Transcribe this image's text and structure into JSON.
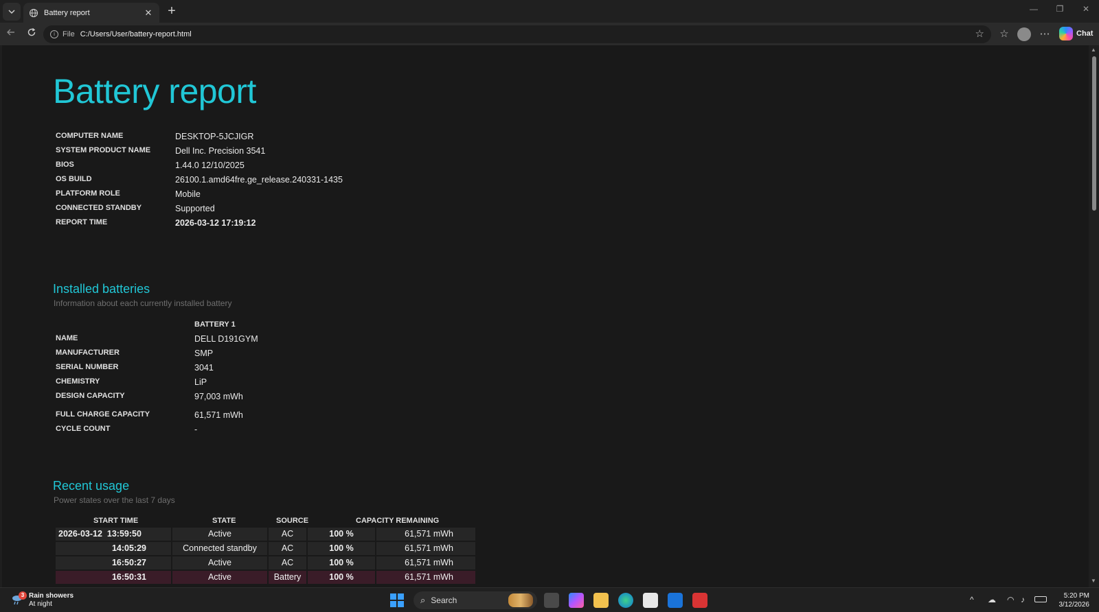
{
  "browser": {
    "tab_title": "Battery report",
    "close_glyph": "✕",
    "new_tab_glyph": "+",
    "url_scheme_label": "File",
    "url": "C:/Users/User/battery-report.html",
    "chat_label": "Chat",
    "icons": [
      "tab-list-icon",
      "globe-icon",
      "back-icon",
      "refresh-icon",
      "info-icon",
      "star-icon",
      "favorites-icon",
      "profile-icon",
      "more-icon",
      "copilot-icon",
      "minimize-icon",
      "restore-icon",
      "close-window-icon"
    ]
  },
  "report": {
    "title": "Battery report",
    "system_info": [
      {
        "key": "COMPUTER NAME",
        "value": "DESKTOP-5JCJIGR"
      },
      {
        "key": "SYSTEM PRODUCT NAME",
        "value": "Dell Inc. Precision 3541"
      },
      {
        "key": "BIOS",
        "value": "1.44.0 12/10/2025"
      },
      {
        "key": "OS BUILD",
        "value": "26100.1.amd64fre.ge_release.240331-1435"
      },
      {
        "key": "PLATFORM ROLE",
        "value": "Mobile"
      },
      {
        "key": "CONNECTED STANDBY",
        "value": "Supported"
      },
      {
        "key": "REPORT TIME",
        "value": "2026-03-12  17:19:12"
      }
    ],
    "installed_batteries": {
      "heading": "Installed batteries",
      "subheading": "Information about each currently installed battery",
      "column": "BATTERY 1",
      "rows": [
        {
          "key": "NAME",
          "value": "DELL D191GYM"
        },
        {
          "key": "MANUFACTURER",
          "value": "SMP"
        },
        {
          "key": "SERIAL NUMBER",
          "value": "3041"
        },
        {
          "key": "CHEMISTRY",
          "value": "LiP"
        },
        {
          "key": "DESIGN CAPACITY",
          "value": "97,003 mWh"
        },
        {
          "key": "FULL CHARGE CAPACITY",
          "value": "61,571 mWh"
        },
        {
          "key": "CYCLE COUNT",
          "value": "-"
        }
      ]
    },
    "recent_usage": {
      "heading": "Recent usage",
      "subheading": "Power states over the last 7 days",
      "headers": {
        "start_time": "START TIME",
        "state": "STATE",
        "source": "SOURCE",
        "capacity": "CAPACITY REMAINING"
      },
      "rows": [
        {
          "date": "2026-03-12",
          "time": "13:59:50",
          "state": "Active",
          "source": "AC",
          "percent": "100 %",
          "mwh": "61,571 mWh"
        },
        {
          "date": "",
          "time": "14:05:29",
          "state": "Connected standby",
          "source": "AC",
          "percent": "100 %",
          "mwh": "61,571 mWh"
        },
        {
          "date": "",
          "time": "16:50:27",
          "state": "Active",
          "source": "AC",
          "percent": "100 %",
          "mwh": "61,571 mWh"
        },
        {
          "date": "",
          "time": "16:50:31",
          "state": "Active",
          "source": "Battery",
          "percent": "100 %",
          "mwh": "61,571 mWh"
        }
      ]
    }
  },
  "taskbar": {
    "weather_title": "Rain showers",
    "weather_sub": "At night",
    "weather_badge": "3",
    "search_label": "Search",
    "time": "5:20 PM",
    "date": "3/12/2026"
  }
}
